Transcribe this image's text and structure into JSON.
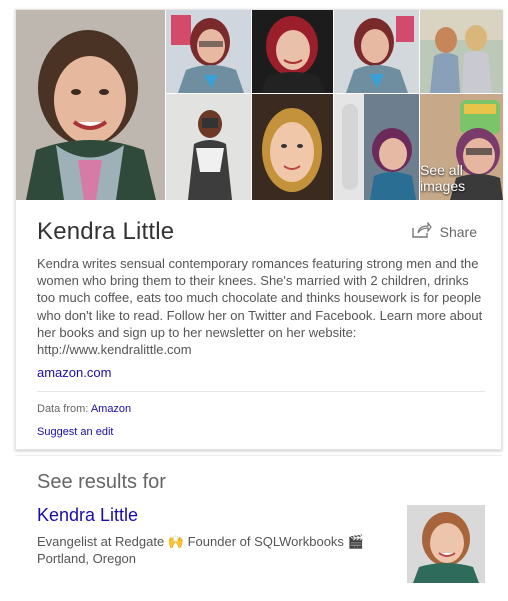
{
  "knowledge_panel": {
    "see_all_images": "See all images",
    "title": "Kendra Little",
    "share_label": "Share",
    "description": "Kendra writes sensual contemporary romances featuring strong men and the women who bring them to their knees. She's married with 2 children, drinks too much coffee, eats too much chocolate and thinks housework is for people who don't like to read. Follow her on Twitter and Facebook. Learn more about her books and sign up to her newsletter on her website: http://www.kendralittle.com",
    "source_link": "amazon.com",
    "data_from_label": "Data from:",
    "data_from_source": "Amazon",
    "suggest_edit": "Suggest an edit"
  },
  "see_results": {
    "heading": "See results for",
    "name": "Kendra Little",
    "line1": "Evangelist at Redgate 🙌 Founder of SQLWorkbooks 🎬",
    "line2": "Portland, Oregon"
  },
  "colors": {
    "link": "#1a0dab",
    "text": "#555555"
  },
  "icons": [
    "share-icon"
  ]
}
